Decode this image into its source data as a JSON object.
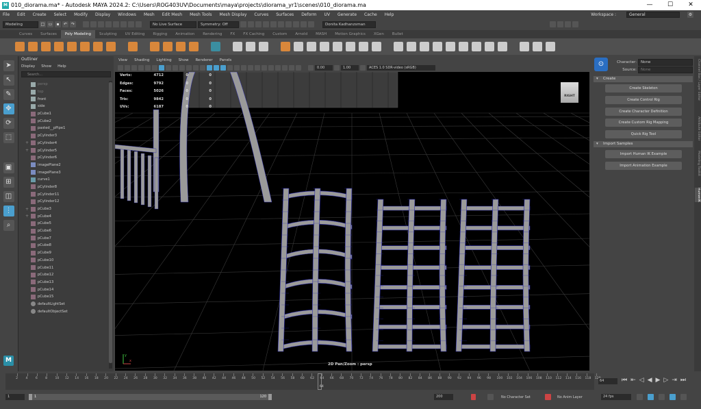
{
  "titlebar": {
    "icon": "M",
    "title": "010_diorama.ma* - Autodesk MAYA 2024.2: C:\\Users\\ROG403UV\\Documents\\maya\\projects\\diorama_yr1\\scenes\\010_diorama.ma",
    "min": "—",
    "max": "☐",
    "close": "✕"
  },
  "menubar": {
    "items": [
      "File",
      "Edit",
      "Create",
      "Select",
      "Modify",
      "Display",
      "Windows",
      "Mesh",
      "Edit Mesh",
      "Mesh Tools",
      "Mesh Display",
      "Curves",
      "Surfaces",
      "Deform",
      "UV",
      "Generate",
      "Cache",
      "Help"
    ],
    "workspace_label": "Workspace :",
    "workspace_value": "General"
  },
  "statusline": {
    "menuset": "Modeling",
    "live_surface": "No Live Surface",
    "symmetry": "Symmetry: Off",
    "user": "Donita Kadhanzsman"
  },
  "shelf_tabs": [
    "Curves",
    "Surfaces",
    "Poly Modeling",
    "Sculpting",
    "UV Editing",
    "Rigging",
    "Animation",
    "Rendering",
    "FX",
    "FX Caching",
    "Custom",
    "Arnold",
    "MASH",
    "Motion Graphics",
    "XGen",
    "Bullet"
  ],
  "active_shelf_tab": "Poly Modeling",
  "outliner": {
    "title": "Outliner",
    "menu": [
      "Display",
      "Show",
      "Help"
    ],
    "search_placeholder": "Search...",
    "items": [
      {
        "name": "persp",
        "icon": "cam",
        "dim": true,
        "exp": ""
      },
      {
        "name": "top",
        "icon": "cam",
        "dim": true,
        "exp": ""
      },
      {
        "name": "front",
        "icon": "cam",
        "dim": false,
        "exp": ""
      },
      {
        "name": "side",
        "icon": "cam",
        "dim": false,
        "exp": ""
      },
      {
        "name": "pCube1",
        "icon": "mesh",
        "dim": false,
        "exp": ""
      },
      {
        "name": "pCube2",
        "icon": "mesh",
        "dim": false,
        "exp": ""
      },
      {
        "name": "pasted__pPipe1",
        "icon": "mesh",
        "dim": false,
        "exp": ""
      },
      {
        "name": "pCylinder3",
        "icon": "mesh",
        "dim": false,
        "exp": ""
      },
      {
        "name": "pCylinder4",
        "icon": "mesh",
        "dim": false,
        "exp": "+"
      },
      {
        "name": "pCylinder5",
        "icon": "mesh",
        "dim": false,
        "exp": "+"
      },
      {
        "name": "pCylinder6",
        "icon": "mesh",
        "dim": false,
        "exp": ""
      },
      {
        "name": "imagePlane2",
        "icon": "img",
        "dim": false,
        "exp": ""
      },
      {
        "name": "imagePlane3",
        "icon": "img",
        "dim": false,
        "exp": ""
      },
      {
        "name": "curve1",
        "icon": "crv",
        "dim": false,
        "exp": ""
      },
      {
        "name": "pCylinder8",
        "icon": "mesh",
        "dim": false,
        "exp": ""
      },
      {
        "name": "pCylinder11",
        "icon": "mesh",
        "dim": false,
        "exp": ""
      },
      {
        "name": "pCylinder12",
        "icon": "mesh",
        "dim": false,
        "exp": ""
      },
      {
        "name": "pCube3",
        "icon": "mesh",
        "dim": false,
        "exp": "+"
      },
      {
        "name": "pCube4",
        "icon": "mesh",
        "dim": false,
        "exp": "+"
      },
      {
        "name": "pCube5",
        "icon": "mesh",
        "dim": false,
        "exp": ""
      },
      {
        "name": "pCube6",
        "icon": "mesh",
        "dim": false,
        "exp": ""
      },
      {
        "name": "pCube7",
        "icon": "mesh",
        "dim": false,
        "exp": ""
      },
      {
        "name": "pCube8",
        "icon": "mesh",
        "dim": false,
        "exp": ""
      },
      {
        "name": "pCube9",
        "icon": "mesh",
        "dim": false,
        "exp": ""
      },
      {
        "name": "pCube10",
        "icon": "mesh",
        "dim": false,
        "exp": ""
      },
      {
        "name": "pCube11",
        "icon": "mesh",
        "dim": false,
        "exp": ""
      },
      {
        "name": "pCube12",
        "icon": "mesh",
        "dim": false,
        "exp": ""
      },
      {
        "name": "pCube13",
        "icon": "mesh",
        "dim": false,
        "exp": ""
      },
      {
        "name": "pCube14",
        "icon": "mesh",
        "dim": false,
        "exp": ""
      },
      {
        "name": "pCube15",
        "icon": "mesh",
        "dim": false,
        "exp": ""
      },
      {
        "name": "defaultLightSet",
        "icon": "set",
        "dim": false,
        "exp": ""
      },
      {
        "name": "defaultObjectSet",
        "icon": "set",
        "dim": false,
        "exp": ""
      }
    ]
  },
  "viewport": {
    "menu": [
      "View",
      "Shading",
      "Lighting",
      "Show",
      "Renderer",
      "Panels"
    ],
    "exposure": "0.00",
    "gamma": "1.00",
    "colorspace": "ACES 1.0 SDR-video (sRGB)",
    "hud": [
      {
        "label": "Verts:",
        "v1": "4712",
        "v2": "0",
        "v3": "0"
      },
      {
        "label": "Edges:",
        "v1": "9792",
        "v2": "0",
        "v3": "0"
      },
      {
        "label": "Faces:",
        "v1": "5026",
        "v2": "0",
        "v3": "0"
      },
      {
        "label": "Tris:",
        "v1": "9842",
        "v2": "0",
        "v3": "0"
      },
      {
        "label": "UVs:",
        "v1": "6187",
        "v2": "0",
        "v3": "0"
      }
    ],
    "viewcube_label": "RIGHT",
    "camera_label": "2D Pan/Zoom : persp",
    "axis_y": "y",
    "axis_x": "x"
  },
  "humanik": {
    "character_label": "Character:",
    "character_value": "None",
    "source_label": "Source:",
    "source_value": "None",
    "create_header": "Create",
    "create_buttons": [
      "Create Skeleton",
      "Create Control Rig",
      "Create Character Definition",
      "Create Custom Rig Mapping",
      "Quick Rig Tool"
    ],
    "samples_header": "Import Samples",
    "sample_buttons": [
      "Import Human IK Example",
      "Import Animation Example"
    ]
  },
  "side_tabs": [
    "Channel Box / Layer Editor",
    "Attribute Editor",
    "Modeling Toolkit",
    "HumanIK"
  ],
  "active_side_tab": "HumanIK",
  "timeline": {
    "ticks": [
      "2",
      "4",
      "6",
      "8",
      "10",
      "12",
      "14",
      "16",
      "18",
      "20",
      "22",
      "24",
      "26",
      "28",
      "30",
      "32",
      "34",
      "36",
      "38",
      "40",
      "42",
      "44",
      "46",
      "48",
      "50",
      "52",
      "54",
      "56",
      "58",
      "60",
      "62",
      "64",
      "66",
      "68",
      "70",
      "72",
      "74",
      "76",
      "78",
      "80",
      "82",
      "84",
      "86",
      "88",
      "90",
      "92",
      "94",
      "96",
      "98",
      "100",
      "102",
      "104",
      "106",
      "108",
      "110",
      "112",
      "114",
      "116",
      "118",
      "120"
    ],
    "current_frame": "64",
    "current_field": "64",
    "range_start": "1",
    "range_inner_start": "1",
    "range_inner_end": "120",
    "range_end_field": "200",
    "char_set": "No Character Set",
    "anim_layer": "No Anim Layer",
    "fps": "24 fps"
  },
  "colors": {
    "accent": "#4a9fce",
    "wire": "#2c2ca8",
    "mesh": "#9a9a9a"
  }
}
